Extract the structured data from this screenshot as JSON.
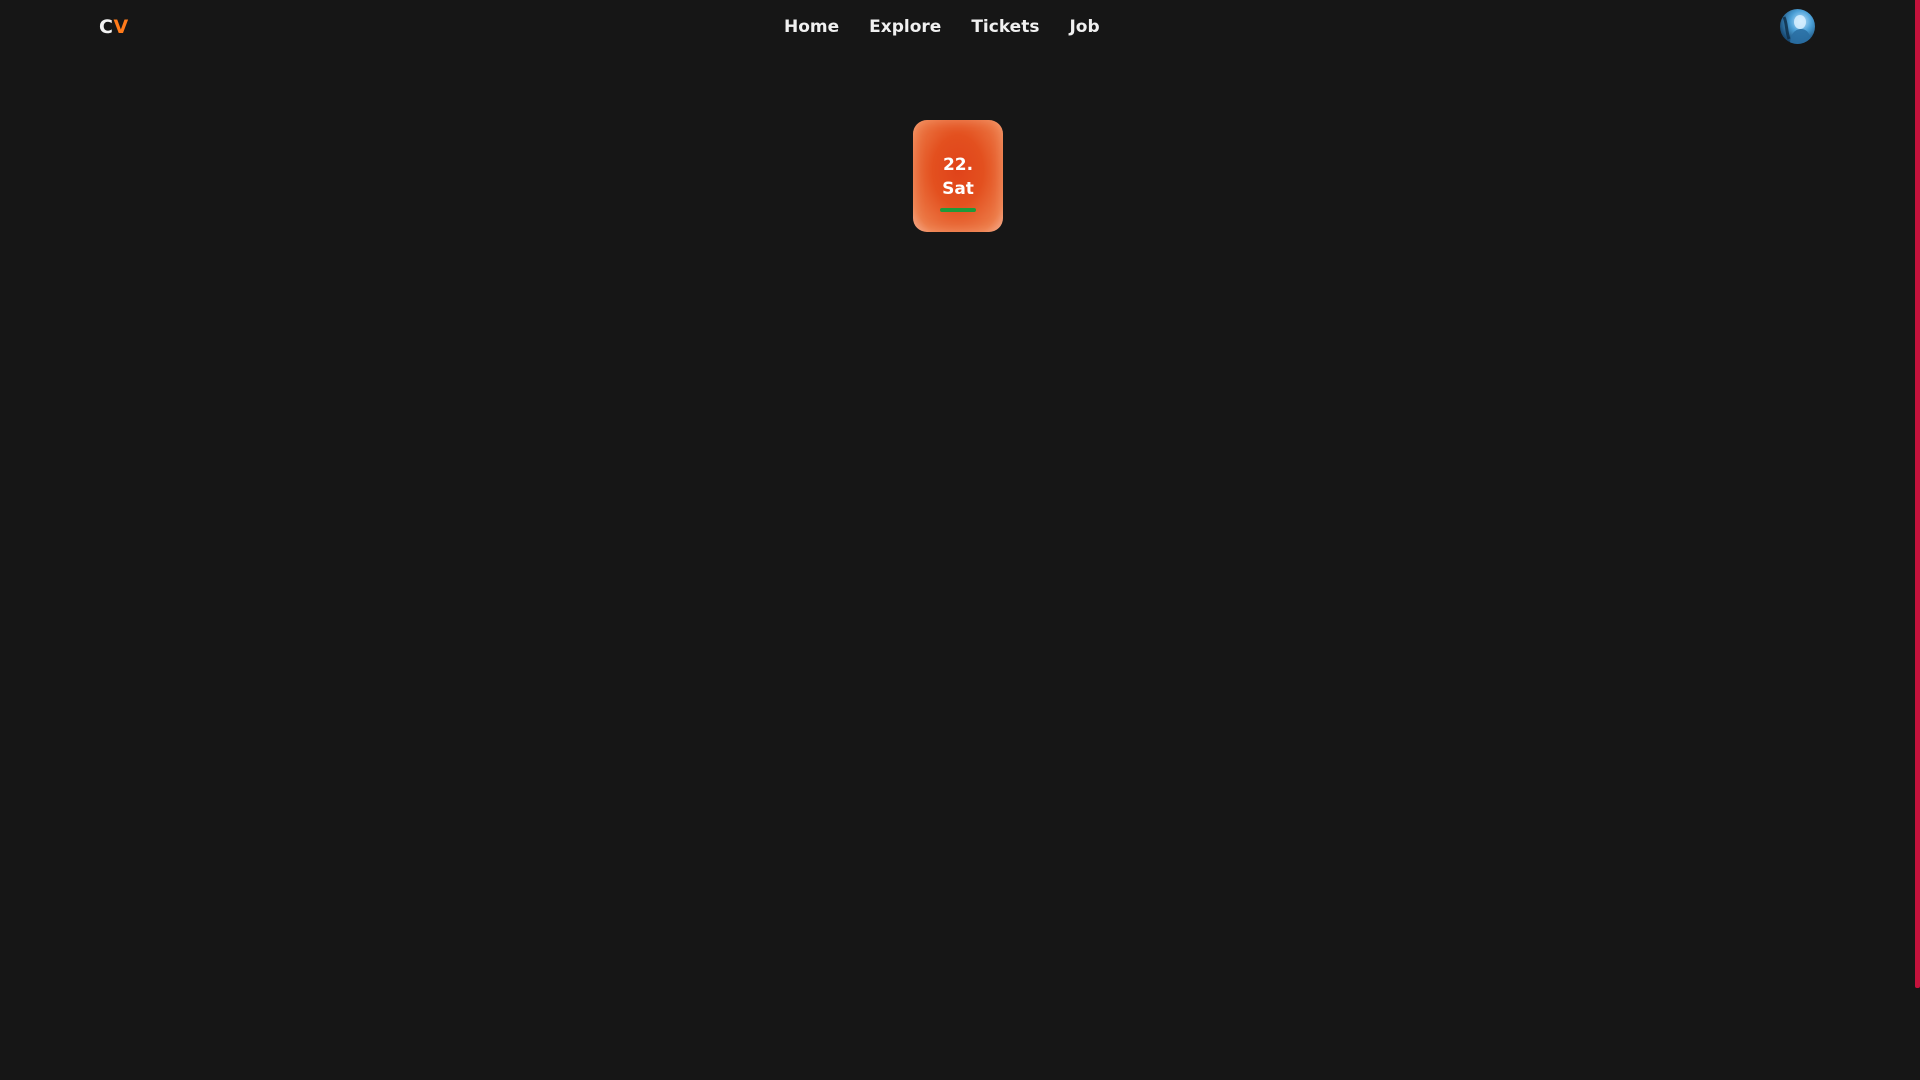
{
  "header": {
    "logo": {
      "first": "C",
      "second": "V"
    },
    "nav": {
      "home": "Home",
      "explore": "Explore",
      "tickets": "Tickets",
      "job": "Job"
    },
    "avatar_icon": "user-avatar-icon"
  },
  "date_card": {
    "day": "22.",
    "weekday": "Sat",
    "indicator_color": "#1f9a3a"
  },
  "colors": {
    "background": "#161616",
    "accent": "#ff7a1a",
    "card": "#e3501f",
    "scrollbar": "#c4123c"
  }
}
